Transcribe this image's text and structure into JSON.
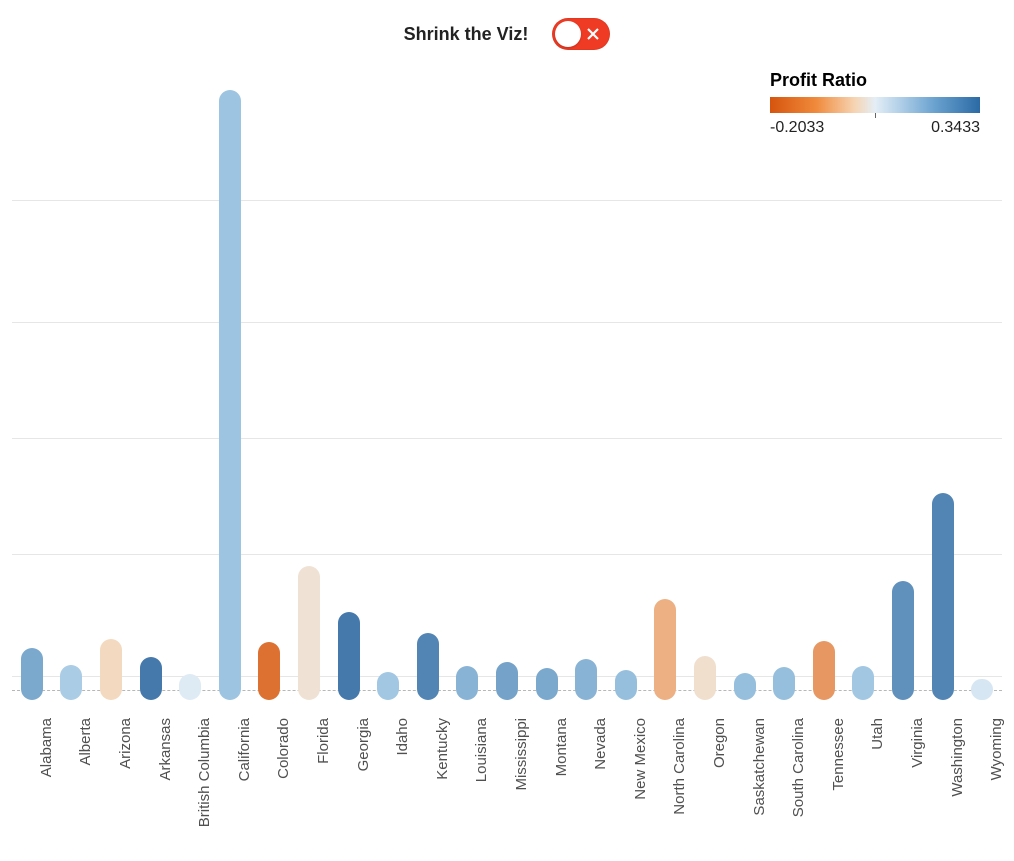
{
  "header": {
    "title": "Shrink the Viz!",
    "toggle_state": "off"
  },
  "legend": {
    "title": "Profit Ratio",
    "min_label": "-0.2033",
    "max_label": "0.3433"
  },
  "chart_data": {
    "type": "bar",
    "ylabel": "",
    "xlabel": "",
    "ylim": [
      0,
      100
    ],
    "color_metric": "Profit Ratio",
    "color_domain": [
      -0.2033,
      0.3433
    ],
    "series": [
      {
        "name": "Alabama",
        "value": 8.5,
        "profit_ratio": 0.22
      },
      {
        "name": "Alberta",
        "value": 5.8,
        "profit_ratio": 0.14
      },
      {
        "name": "Arizona",
        "value": 10.0,
        "profit_ratio": -0.08
      },
      {
        "name": "Arkansas",
        "value": 7.0,
        "profit_ratio": 0.3
      },
      {
        "name": "British Columbia",
        "value": 4.2,
        "profit_ratio": 0.02
      },
      {
        "name": "California",
        "value": 100.0,
        "profit_ratio": 0.17
      },
      {
        "name": "Colorado",
        "value": 9.5,
        "profit_ratio": -0.18
      },
      {
        "name": "Florida",
        "value": 22.0,
        "profit_ratio": -0.05
      },
      {
        "name": "Georgia",
        "value": 14.5,
        "profit_ratio": 0.3
      },
      {
        "name": "Idaho",
        "value": 4.6,
        "profit_ratio": 0.16
      },
      {
        "name": "Kentucky",
        "value": 11.0,
        "profit_ratio": 0.28
      },
      {
        "name": "Louisiana",
        "value": 5.6,
        "profit_ratio": 0.2
      },
      {
        "name": "Mississippi",
        "value": 6.2,
        "profit_ratio": 0.23
      },
      {
        "name": "Montana",
        "value": 5.2,
        "profit_ratio": 0.22
      },
      {
        "name": "Nevada",
        "value": 6.8,
        "profit_ratio": 0.2
      },
      {
        "name": "New Mexico",
        "value": 5.0,
        "profit_ratio": 0.18
      },
      {
        "name": "North Carolina",
        "value": 16.5,
        "profit_ratio": -0.13
      },
      {
        "name": "Oregon",
        "value": 7.2,
        "profit_ratio": -0.06
      },
      {
        "name": "Saskatchewan",
        "value": 4.4,
        "profit_ratio": 0.18
      },
      {
        "name": "South Carolina",
        "value": 5.4,
        "profit_ratio": 0.18
      },
      {
        "name": "Tennessee",
        "value": 9.6,
        "profit_ratio": -0.15
      },
      {
        "name": "Utah",
        "value": 5.6,
        "profit_ratio": 0.16
      },
      {
        "name": "Virginia",
        "value": 19.5,
        "profit_ratio": 0.26
      },
      {
        "name": "Washington",
        "value": 34.0,
        "profit_ratio": 0.28
      },
      {
        "name": "Wyoming",
        "value": 3.4,
        "profit_ratio": 0.04
      }
    ]
  }
}
